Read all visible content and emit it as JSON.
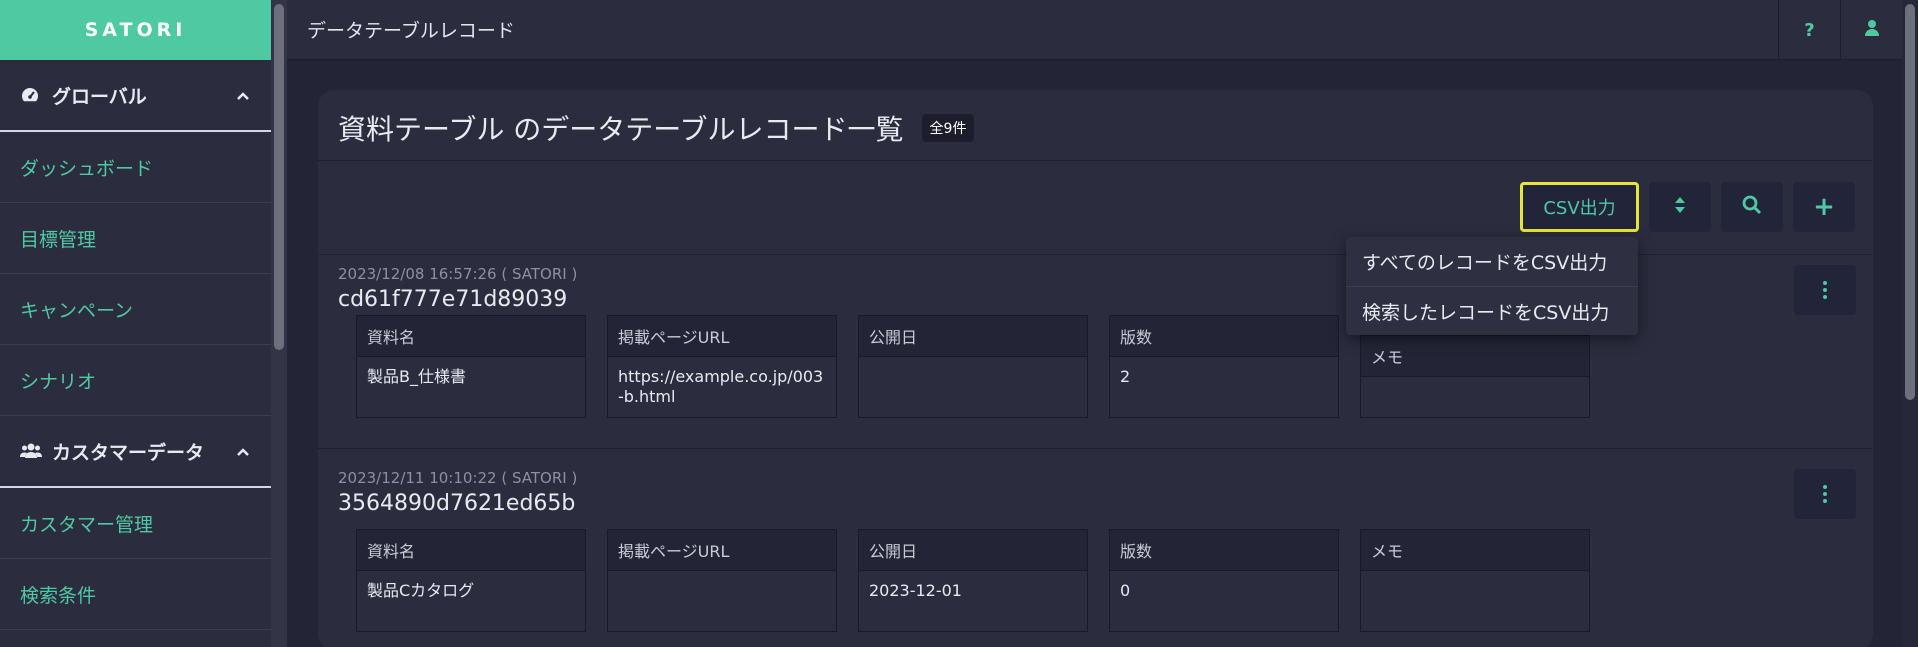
{
  "sidebar": {
    "logo": "SATORI",
    "sections": [
      {
        "label": "グローバル",
        "items": [
          "ダッシュボード",
          "目標管理",
          "キャンペーン",
          "シナリオ"
        ]
      },
      {
        "label": "カスタマーデータ",
        "items": [
          "カスタマー管理",
          "検索条件"
        ]
      }
    ]
  },
  "topbar": {
    "title": "データテーブルレコード",
    "help": "?"
  },
  "card": {
    "title": "資料テーブル のデータテーブルレコード一覧",
    "count": "全9件",
    "csv_button": "CSV出力",
    "add_button": "+"
  },
  "dropdown": {
    "items": [
      "すべてのレコードをCSV出力",
      "検索したレコードをCSV出力"
    ]
  },
  "records": [
    {
      "meta": "2023/12/08 16:57:26 ( SATORI )",
      "id": "cd61f777e71d89039",
      "fields": [
        {
          "label": "資料名",
          "value": "製品B_仕様書"
        },
        {
          "label": "掲載ページURL",
          "value": "https://example.co.jp/003-b.html"
        },
        {
          "label": "公開日",
          "value": ""
        },
        {
          "label": "版数",
          "value": "2"
        },
        {
          "label": "メモ",
          "value": ""
        }
      ]
    },
    {
      "meta": "2023/12/11 10:10:22 ( SATORI )",
      "id": "3564890d7621ed65b",
      "fields": [
        {
          "label": "資料名",
          "value": "製品Cカタログ"
        },
        {
          "label": "掲載ページURL",
          "value": ""
        },
        {
          "label": "公開日",
          "value": "2023-12-01"
        },
        {
          "label": "版数",
          "value": "0"
        },
        {
          "label": "メモ",
          "value": ""
        }
      ]
    }
  ],
  "colors": {
    "accent": "#4ec9a2",
    "highlight": "#e6e639",
    "background": "#232536",
    "panel": "#2b2d3e"
  },
  "icons": [
    "tachometer-icon",
    "users-icon",
    "chevron-up-icon",
    "help-icon",
    "user-icon",
    "sort-icon",
    "search-icon",
    "plus-icon",
    "kebab-menu-icon"
  ]
}
